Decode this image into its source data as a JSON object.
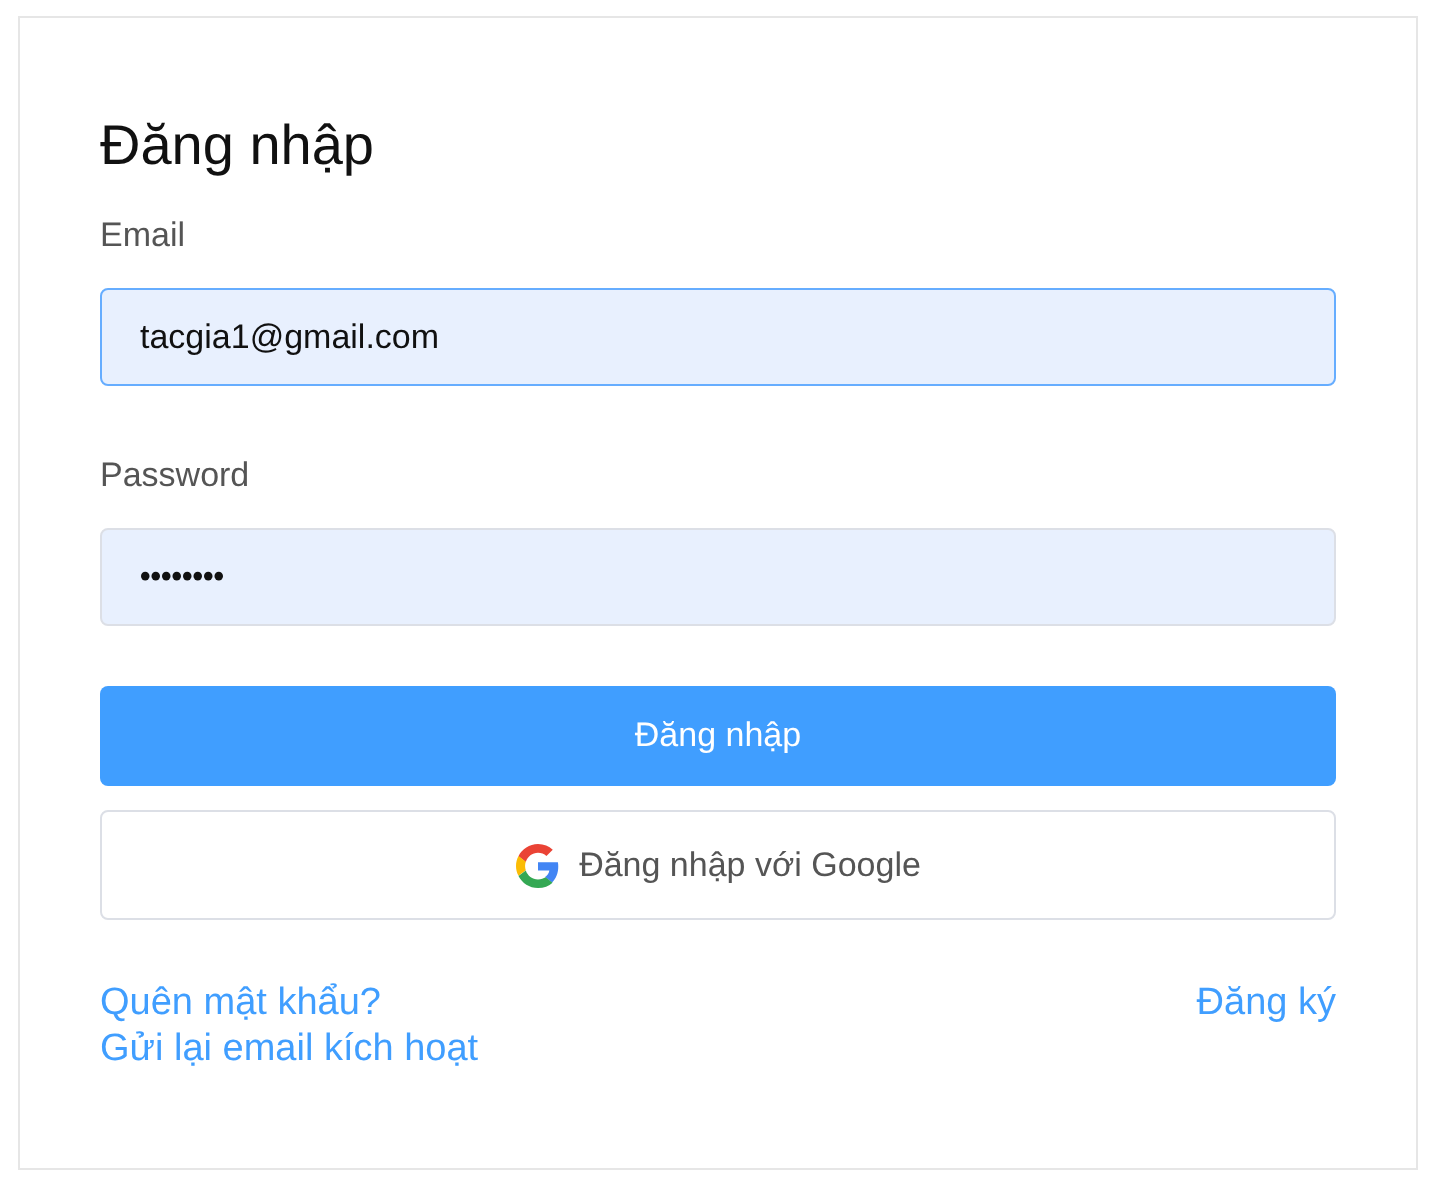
{
  "title": "Đăng nhập",
  "fields": [
    {
      "label": "Email",
      "kind": "text",
      "value": "tacgia1@gmail.com",
      "focused": true
    },
    {
      "label": "Password",
      "kind": "password",
      "value": "••••••••",
      "focused": false
    }
  ],
  "submit_button": "Đăng nhập",
  "google_button": "Đăng nhập với Google",
  "links_left": [
    "Quên mật khẩu?",
    "Gửi lại email kích hoạt"
  ],
  "link_right": "Đăng ký"
}
